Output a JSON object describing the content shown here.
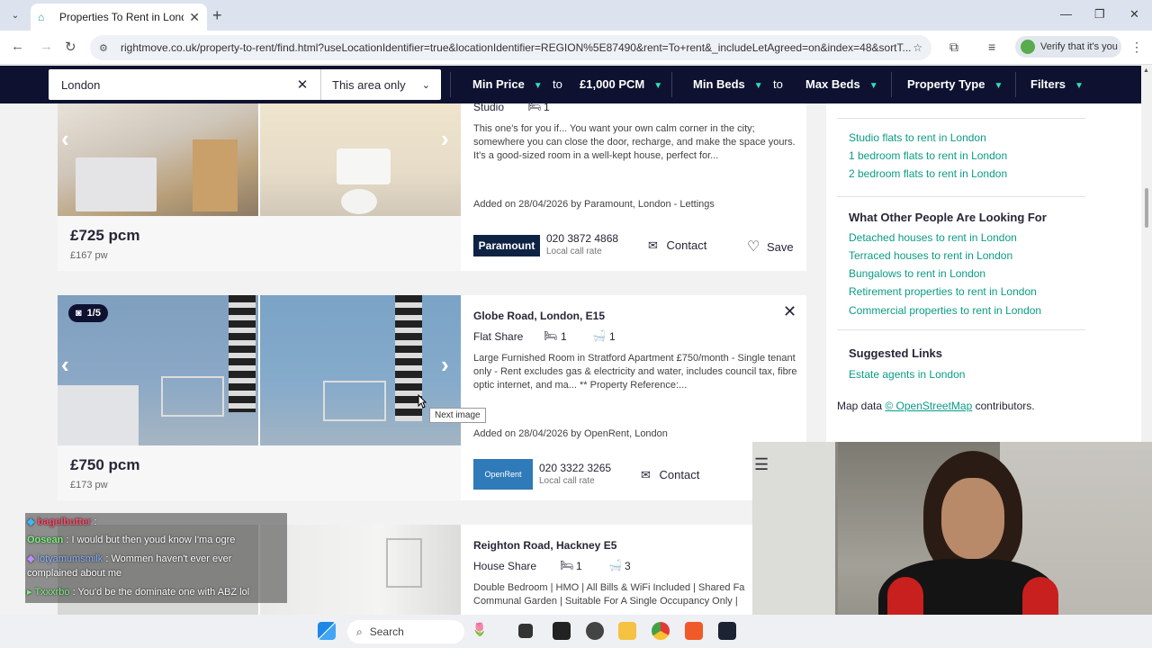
{
  "browser": {
    "tab_title": "Properties To Rent in London | ",
    "url": "rightmove.co.uk/property-to-rent/find.html?useLocationIdentifier=true&locationIdentifier=REGION%5E87490&rent=To+rent&_includeLetAgreed=on&index=48&sortT...",
    "verify_label": "Verify that it's you"
  },
  "search": {
    "location": "London",
    "radius": "This area only",
    "min_price": "Min Price",
    "to1": "to",
    "max_price": "£1,000 PCM",
    "min_beds": "Min Beds",
    "to2": "to",
    "max_beds": "Max Beds",
    "property_type": "Property Type",
    "filters": "Filters"
  },
  "listings": [
    {
      "type": "Studio",
      "beds": "1",
      "description": "This one's for you if... You want your own calm corner in the city; somewhere you can close the door, recharge, and make the space yours. It's a good-sized room in a well-kept house, perfect for...",
      "added": "Added on 28/04/2026 by Paramount, London - Lettings",
      "agent_logo": "Paramount",
      "phone": "020 3872 4868",
      "rate": "Local call rate",
      "contact": "Contact",
      "save": "Save",
      "price": "£725 pcm",
      "price_pw": "£167 pw"
    },
    {
      "badge": "1/5",
      "address": "Globe Road, London, E15",
      "type": "Flat Share",
      "beds": "1",
      "baths": "1",
      "description": "Large Furnished Room in Stratford Apartment £750/month - Single tenant only - Rent excludes gas & electricity and water, includes council tax, fibre optic internet, and ma... ** Property Reference:...",
      "added": "Added on 28/04/2026 by OpenRent, London",
      "agent_logo": "OpenRent",
      "phone": "020 3322 3265",
      "rate": "Local call rate",
      "contact": "Contact",
      "price": "£750 pcm",
      "price_pw": "£173 pw",
      "tooltip": "Next image"
    },
    {
      "address": "Reighton Road, Hackney E5",
      "type": "House Share",
      "beds": "1",
      "baths": "3",
      "description": "Double Bedroom | HMO | All Bills & WiFi Included | Shared Fa Communal Garden | Suitable For A Single Occupancy Only |"
    }
  ],
  "sidebar": {
    "links_a": [
      "Studio flats to rent in London",
      "1 bedroom flats to rent in London",
      "2 bedroom flats to rent in London"
    ],
    "heading_b": "What Other People Are Looking For",
    "links_b": [
      "Detached houses to rent in London",
      "Terraced houses to rent in London",
      "Bungalows to rent in London",
      "Retirement properties to rent in London",
      "Commercial properties to rent in London"
    ],
    "heading_c": "Suggested Links",
    "links_c": [
      "Estate agents in London"
    ],
    "map_prefix": "Map data ",
    "map_link": "© OpenStreetMap",
    "map_suffix": " contributors."
  },
  "chat": [
    {
      "user": "bagelbutter",
      "text": ":"
    },
    {
      "user": "Oosean",
      "text": ": I would but then youd know I'ma ogre"
    },
    {
      "user": "lotyamumsmilk",
      "text": ": Wommen haven't ever ever"
    },
    {
      "user": "",
      "text": "complained about me"
    },
    {
      "user": "Txxxrbo",
      "text": ": You'd be the dominate one with ABZ lol"
    }
  ],
  "taskbar": {
    "search": "Search"
  }
}
